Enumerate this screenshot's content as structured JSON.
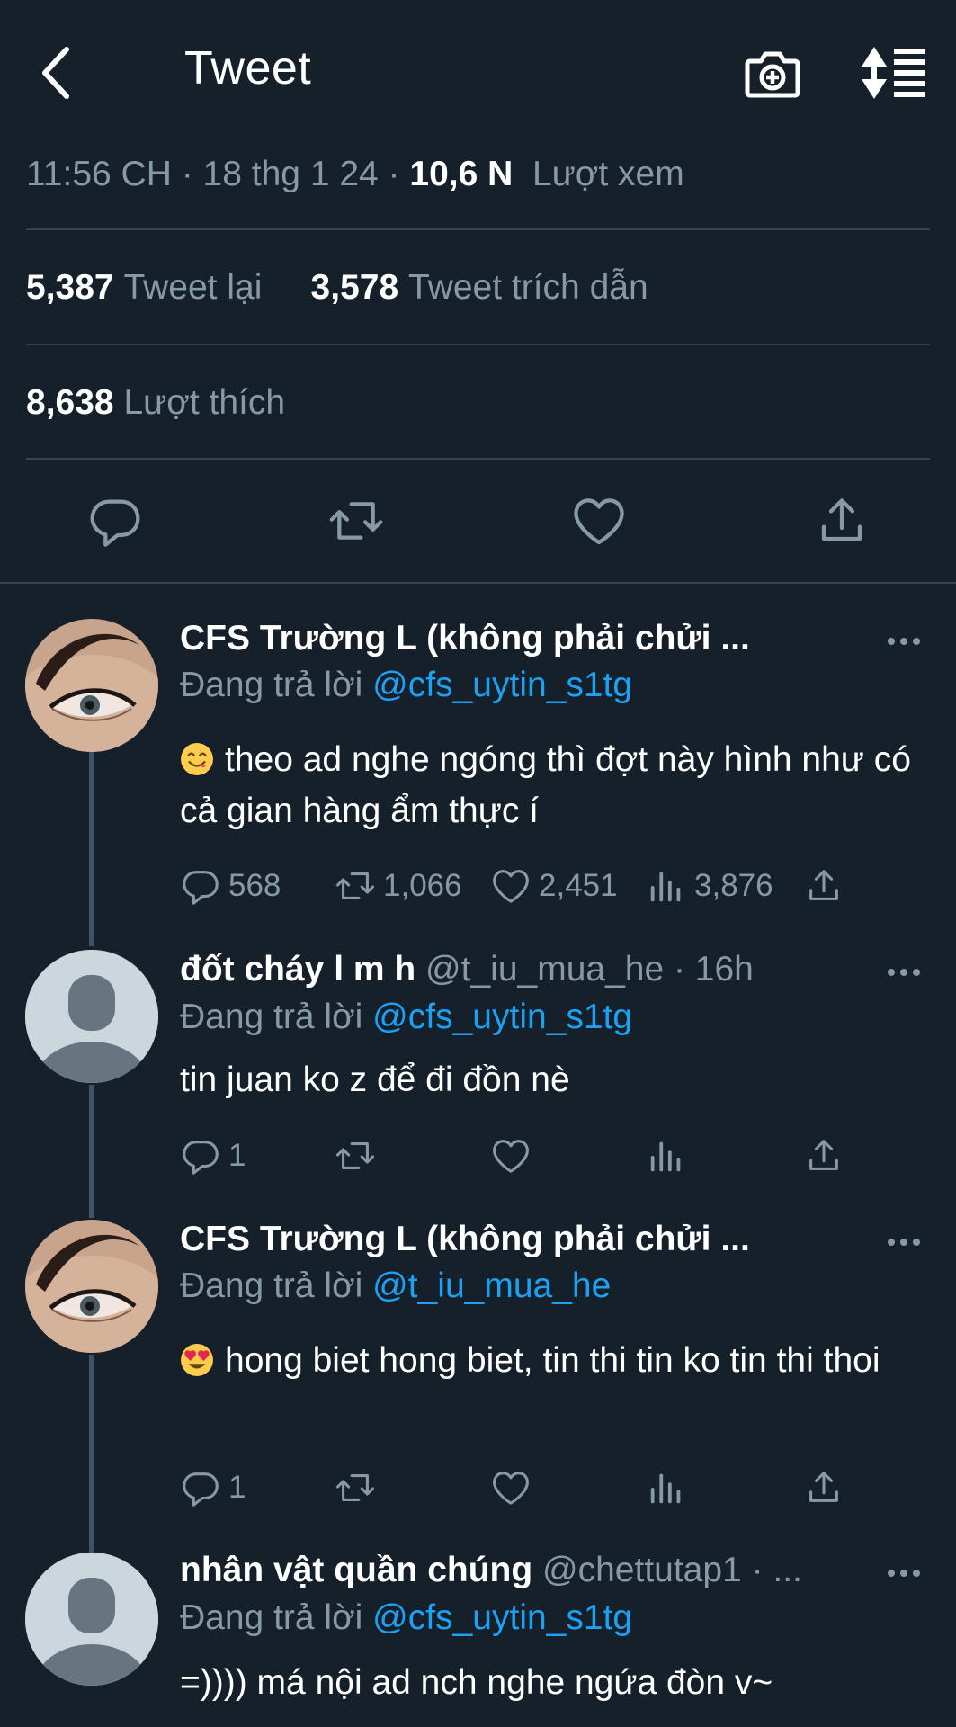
{
  "header": {
    "title": "Tweet",
    "back_icon": "chevron-left-icon",
    "camera_icon": "camera-plus-icon",
    "sort_icon": "sort-icon"
  },
  "tweet_meta": {
    "time": "11:56 CH",
    "date": "18 thg 1 24",
    "views_count": "10,6 N",
    "views_label": "Lượt xem"
  },
  "stats": {
    "retweets_count": "5,387",
    "retweets_label": "Tweet lại",
    "quotes_count": "3,578",
    "quotes_label": "Tweet trích dẫn",
    "likes_count": "8,638",
    "likes_label": "Lượt thích"
  },
  "colors": {
    "background": "#15202b",
    "muted": "#8899a6",
    "accent": "#1da1f2",
    "divider": "#38444d"
  },
  "replies": [
    {
      "name": "CFS Trường L (không phải chửi ...",
      "handle": "",
      "reply_prefix": "Đang trả lời",
      "reply_to": "@cfs_uytin_s1tg",
      "emoji": "savoring-face-emoji",
      "text": "theo ad nghe ngóng thì đợt này hình như có cả gian hàng ẩm thực í",
      "reply_count": "568",
      "retweet_count": "1,066",
      "like_count": "2,451",
      "view_count": "3,876"
    },
    {
      "name": "đốt cháy l m h",
      "handle": "@t_iu_mua_he · 16h",
      "reply_prefix": "Đang trả lời",
      "reply_to": "@cfs_uytin_s1tg",
      "text": "tin juan ko z để đi đồn nè",
      "reply_count": "1"
    },
    {
      "name": "CFS Trường L (không phải chửi ...",
      "handle": "",
      "reply_prefix": "Đang trả lời",
      "reply_to": "@t_iu_mua_he",
      "emoji": "heart-eyes-emoji",
      "text": "hong biet hong biet, tin thi tin ko tin thi thoi",
      "reply_count": "1"
    },
    {
      "name": "nhân vật quần chúng",
      "handle": "@chettutap1 · ...",
      "reply_prefix": "Đang trả lời",
      "reply_to": "@cfs_uytin_s1tg",
      "text": "=)))) má nội ad nch nghe ngứa đòn v~"
    }
  ]
}
